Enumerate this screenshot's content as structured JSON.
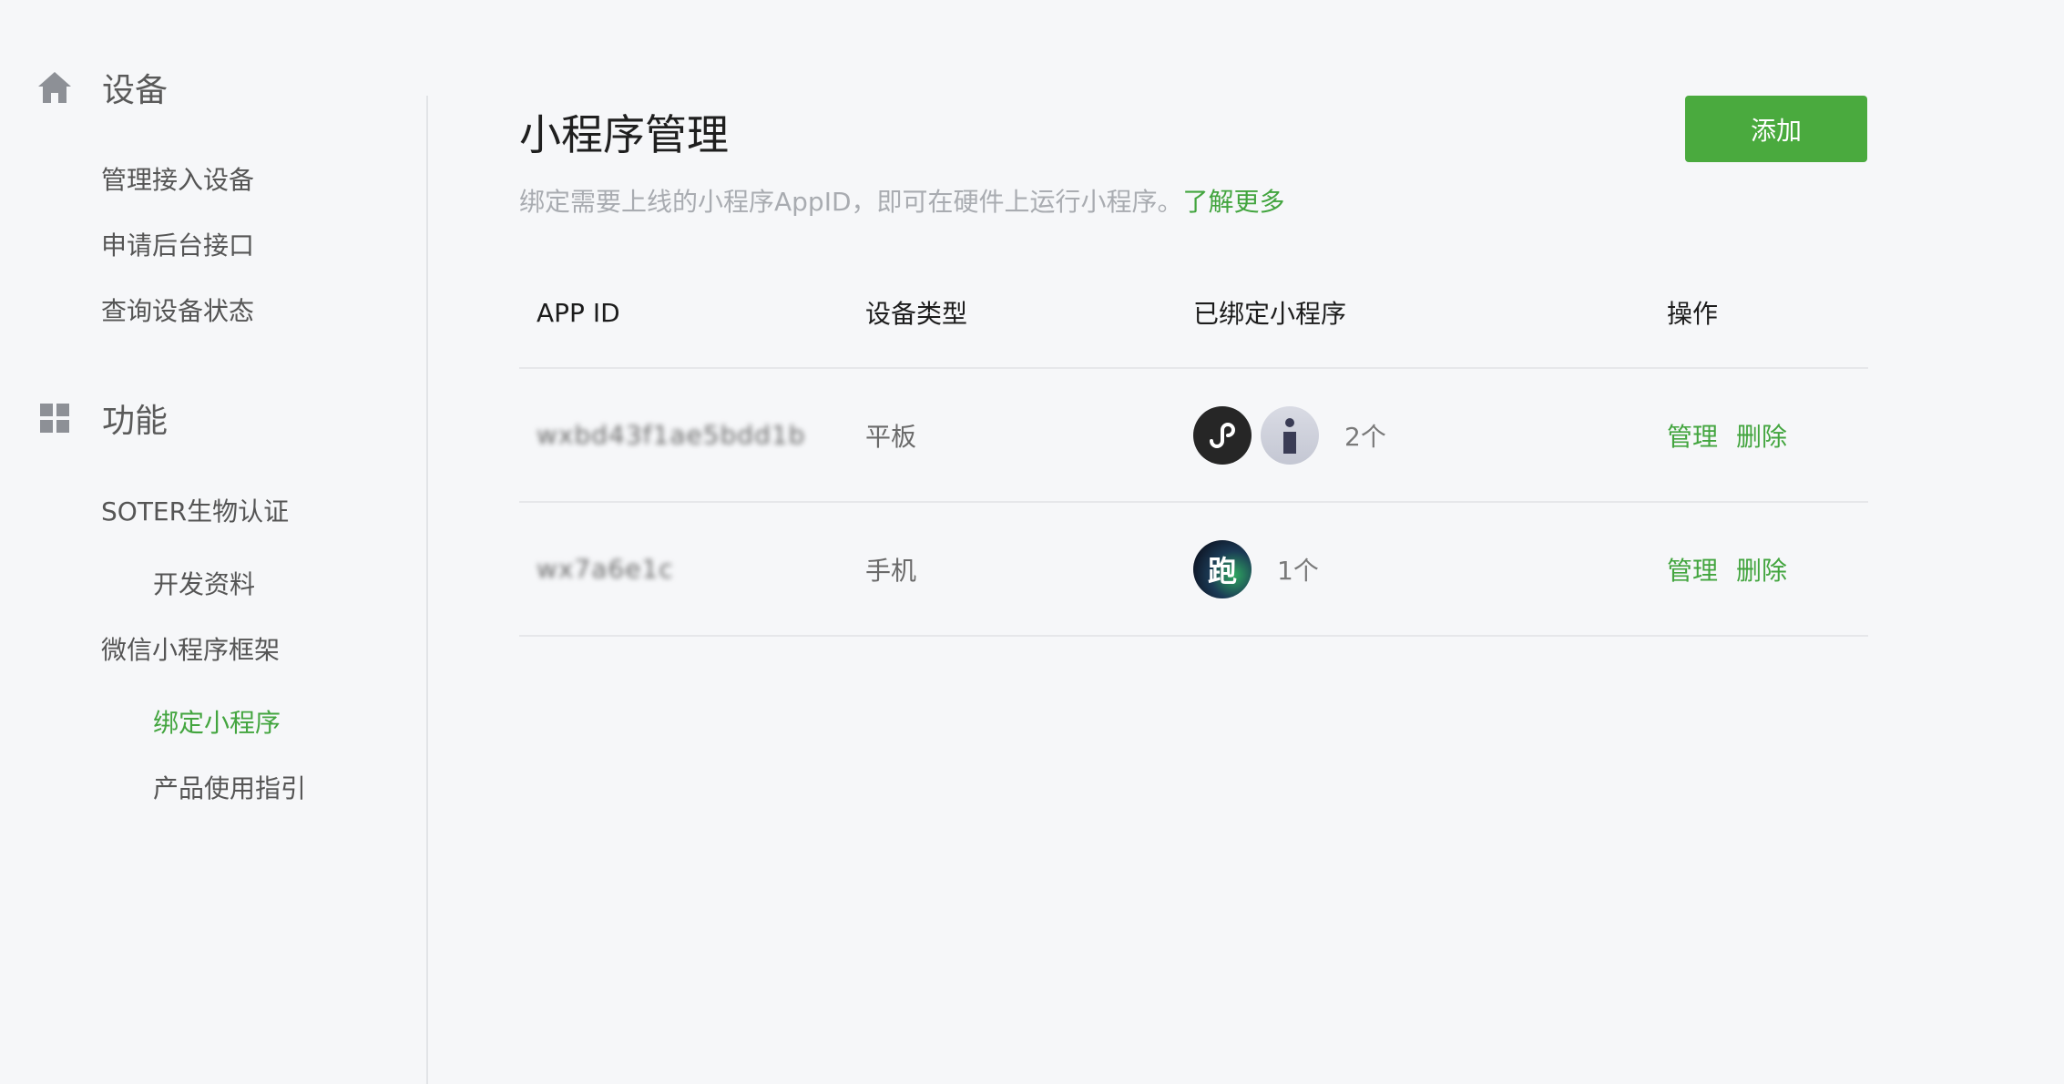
{
  "sidebar": {
    "sections": [
      {
        "title": "设备",
        "icon": "home-icon",
        "items": [
          "管理接入设备",
          "申请后台接口",
          "查询设备状态"
        ]
      },
      {
        "title": "功能",
        "icon": "grid-icon",
        "items": [
          "SOTER生物认证",
          "开发资料",
          "微信小程序框架",
          "绑定小程序",
          "产品使用指引"
        ]
      }
    ],
    "active_item": "绑定小程序"
  },
  "main": {
    "title": "小程序管理",
    "description": "绑定需要上线的小程序AppID，即可在硬件上运行小程序。",
    "learn_more": "了解更多",
    "add_button": "添加",
    "table": {
      "headers": [
        "APP ID",
        "设备类型",
        "已绑定小程序",
        "操作"
      ],
      "rows": [
        {
          "app_id": "wxbd43f1ae5bdd1b",
          "device_type": "平板",
          "bound_icons": [
            "miniprogram-logo-icon",
            "avatar-figure-icon"
          ],
          "bound_count": "2个",
          "manage": "管理",
          "delete": "删除"
        },
        {
          "app_id": "wx7a6e1c",
          "device_type": "手机",
          "bound_icons": [
            "run-app-avatar-icon"
          ],
          "run_avatar_text": "跑",
          "bound_count": "1个",
          "manage": "管理",
          "delete": "删除"
        }
      ]
    }
  },
  "colors": {
    "accent": "#43a53f",
    "button": "#4aaa3e",
    "background": "#f6f7f9"
  }
}
